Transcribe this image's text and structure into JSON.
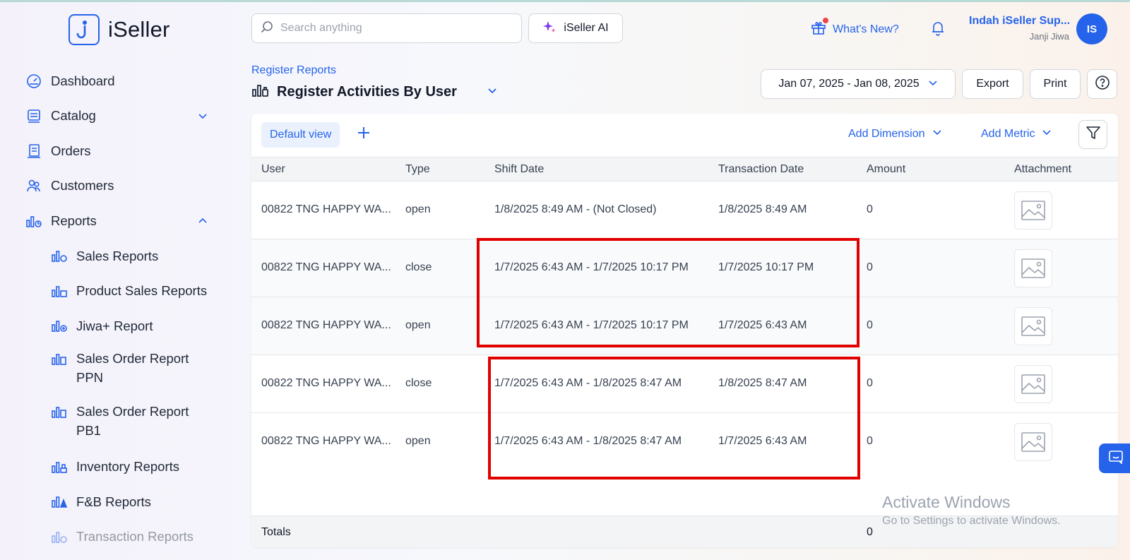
{
  "app": {
    "name": "iSeller"
  },
  "search": {
    "placeholder": "Search anything"
  },
  "header": {
    "ai_label": "iSeller AI",
    "whats_new": "What's New?",
    "user_name": "Indah iSeller Sup...",
    "user_store": "Janji Jiwa",
    "avatar_initials": "IS"
  },
  "sidebar": {
    "items": [
      {
        "label": "Dashboard",
        "icon": "dashboard-icon"
      },
      {
        "label": "Catalog",
        "icon": "catalog-icon"
      },
      {
        "label": "Orders",
        "icon": "orders-icon"
      },
      {
        "label": "Customers",
        "icon": "customers-icon"
      },
      {
        "label": "Reports",
        "icon": "reports-icon"
      }
    ],
    "reports_sub": [
      {
        "label": "Sales Reports"
      },
      {
        "label": "Product Sales Reports"
      },
      {
        "label": "Jiwa+ Report"
      },
      {
        "label": "Sales Order Report PPN"
      },
      {
        "label": "Sales Order Report PB1"
      },
      {
        "label": "Inventory Reports"
      },
      {
        "label": "F&B Reports"
      },
      {
        "label": "Transaction Reports"
      }
    ]
  },
  "page": {
    "breadcrumb": "Register Reports",
    "title": "Register Activities By User",
    "date_range": "Jan 07, 2025 - Jan 08, 2025",
    "export_label": "Export",
    "print_label": "Print"
  },
  "toolbar": {
    "default_view": "Default view",
    "add_dimension": "Add Dimension",
    "add_metric": "Add Metric"
  },
  "table": {
    "columns": [
      "User",
      "Type",
      "Shift Date",
      "Transaction Date",
      "Amount",
      "Attachment"
    ],
    "rows": [
      {
        "user": "00822 TNG HAPPY WA...",
        "type": "open",
        "shift_date": "1/8/2025 8:49 AM - (Not Closed)",
        "transaction_date": "1/8/2025 8:49 AM",
        "amount": "0"
      },
      {
        "user": "00822 TNG HAPPY WA...",
        "type": "close",
        "shift_date": "1/7/2025 6:43 AM - 1/7/2025 10:17 PM",
        "transaction_date": "1/7/2025 10:17 PM",
        "amount": "0"
      },
      {
        "user": "00822 TNG HAPPY WA...",
        "type": "open",
        "shift_date": "1/7/2025 6:43 AM - 1/7/2025 10:17 PM",
        "transaction_date": "1/7/2025 6:43 AM",
        "amount": "0"
      },
      {
        "user": "00822 TNG HAPPY WA...",
        "type": "close",
        "shift_date": "1/7/2025 6:43 AM - 1/8/2025 8:47 AM",
        "transaction_date": "1/8/2025 8:47 AM",
        "amount": "0"
      },
      {
        "user": "00822 TNG HAPPY WA...",
        "type": "open",
        "shift_date": "1/7/2025 6:43 AM - 1/8/2025 8:47 AM",
        "transaction_date": "1/7/2025 6:43 AM",
        "amount": "0"
      }
    ],
    "totals_label": "Totals",
    "totals_amount": "0"
  },
  "watermark": {
    "line1": "Activate Windows",
    "line2": "Go to Settings to activate Windows."
  },
  "colors": {
    "accent": "#2563eb",
    "highlight": "#e00000"
  }
}
